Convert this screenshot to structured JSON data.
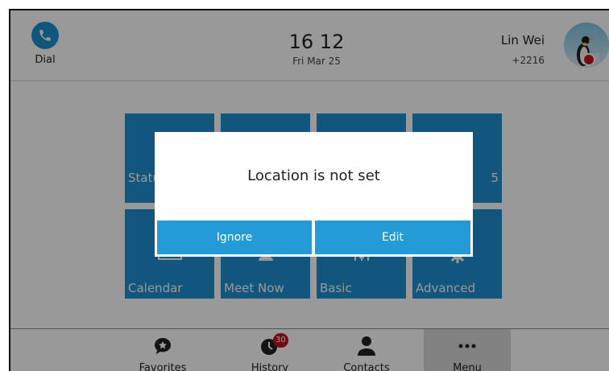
{
  "status_bar": {
    "dial_label": "Dial",
    "time": "16 12",
    "date": "Fri Mar 25",
    "account_name": "Lin Wei",
    "account_number": "+2216",
    "presence_color": "#c4121c"
  },
  "tiles": {
    "status_label": "Statu",
    "five_label": "5",
    "calendar_label": "Calendar",
    "meet_now_label": "Meet Now",
    "basic_label": "Basic",
    "advanced_label": "Advanced"
  },
  "bottom_nav": {
    "favorites_label": "Favorites",
    "history_label": "History",
    "history_badge": "30",
    "contacts_label": "Contacts",
    "menu_label": "Menu"
  },
  "dialog": {
    "message": "Location is not set",
    "ignore_label": "Ignore",
    "edit_label": "Edit"
  },
  "colors": {
    "accent": "#1f8fd1",
    "dialog_button": "#249ad6",
    "badge": "#c4121c"
  }
}
